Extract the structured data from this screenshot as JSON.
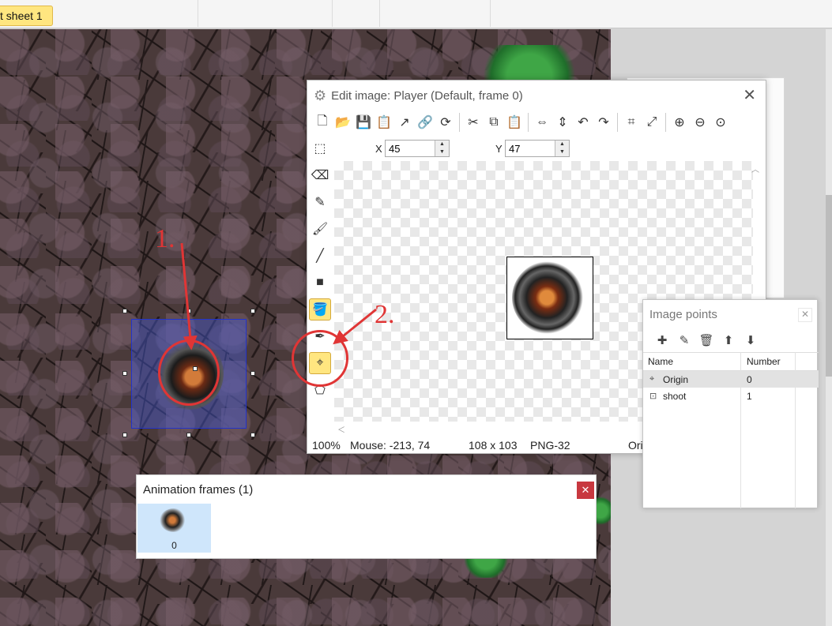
{
  "tab": {
    "label": "t sheet 1"
  },
  "edit_window": {
    "title": "Edit image: Player (Default, frame 0)",
    "x_label": "X",
    "x_value": "45",
    "y_label": "Y",
    "y_value": "47"
  },
  "status": {
    "zoom": "100%",
    "mouse": "Mouse: -213, 74",
    "size": "108 x 103",
    "format": "PNG-32",
    "extra": "Ori"
  },
  "image_points": {
    "title": "Image points",
    "col_name": "Name",
    "col_number": "Number",
    "rows": [
      {
        "name": "Origin",
        "number": "0"
      },
      {
        "name": "shoot",
        "number": "1"
      }
    ]
  },
  "animation_frames": {
    "title": "Animation frames (1)",
    "frames": [
      {
        "label": "0"
      }
    ]
  },
  "annotations": {
    "one": "1.",
    "two": "2."
  },
  "colors": {
    "annotation": "#e03535",
    "active_tool": "#ffe680",
    "close_red": "#c8383f"
  }
}
